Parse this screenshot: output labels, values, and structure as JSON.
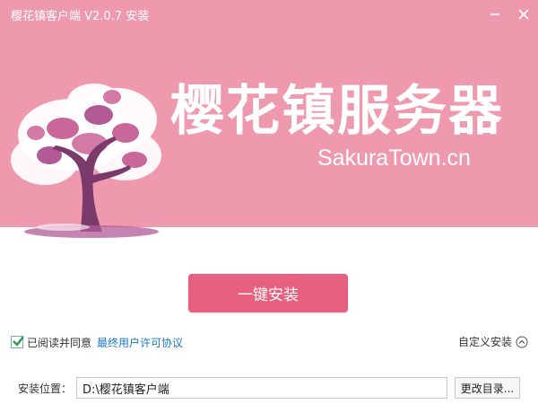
{
  "window": {
    "title": "樱花镇客户端 V2.0.7 安装",
    "minimize_icon": "minimize-icon",
    "close_icon": "close-icon"
  },
  "banner": {
    "app_name": "樱花镇服务器",
    "domain": "SakuraTown.cn",
    "background_color": "#ef99ae",
    "logo": "cherry-blossom-tree-icon"
  },
  "install": {
    "button_label": "一键安装",
    "button_color": "#e8607f"
  },
  "agreement": {
    "checked": true,
    "label": "已阅读并同意",
    "link_label": "最终用户许可协议",
    "link_color": "#1a77c9"
  },
  "custom_install": {
    "label": "自定义安装",
    "icon": "chevron-up-circle-icon"
  },
  "location": {
    "label": "安装位置：",
    "path": "D:\\樱花镇客户端",
    "browse_label": "更改目录..."
  }
}
